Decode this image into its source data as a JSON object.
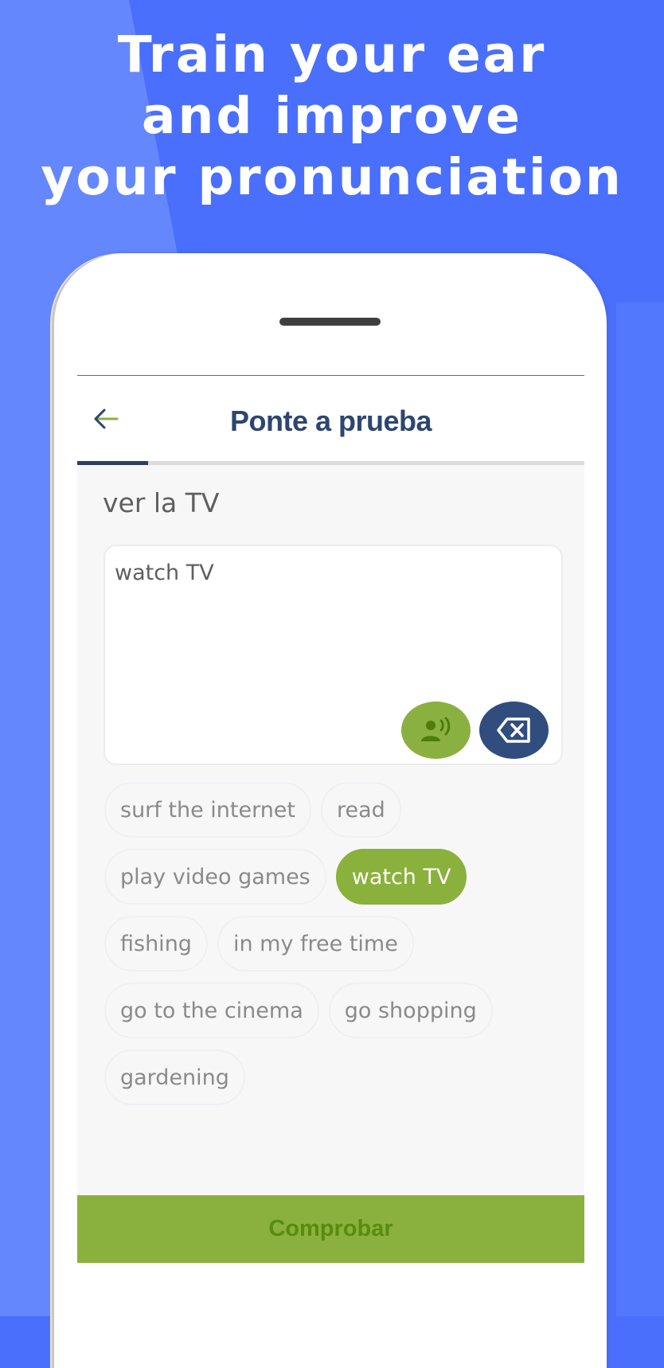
{
  "promo": {
    "headline_lines": [
      "Train your ear",
      "and improve",
      "your pronunciation"
    ]
  },
  "app": {
    "header": {
      "back_icon": "arrow-left-icon",
      "title": "Ponte a prueba"
    },
    "progress": {
      "fraction": 0.14
    },
    "exercise": {
      "prompt": "ver la TV",
      "answer_value": "watch TV",
      "listen_icon": "speaking-person-icon",
      "delete_icon": "backspace-icon"
    },
    "word_bank": [
      {
        "label": "surf the internet",
        "selected": false
      },
      {
        "label": "read",
        "selected": false
      },
      {
        "label": "play video games",
        "selected": false
      },
      {
        "label": "watch TV",
        "selected": true
      },
      {
        "label": "fishing",
        "selected": false
      },
      {
        "label": "in my free time",
        "selected": false
      },
      {
        "label": "go to the cinema",
        "selected": false
      },
      {
        "label": "go shopping",
        "selected": false
      },
      {
        "label": "gardening",
        "selected": false
      }
    ],
    "check_button": "Comprobar"
  },
  "colors": {
    "background_blue": "#4a6ffd",
    "brand_navy": "#2d4670",
    "accent_green": "#8ab13e",
    "check_text_green": "#5a8a0f"
  }
}
